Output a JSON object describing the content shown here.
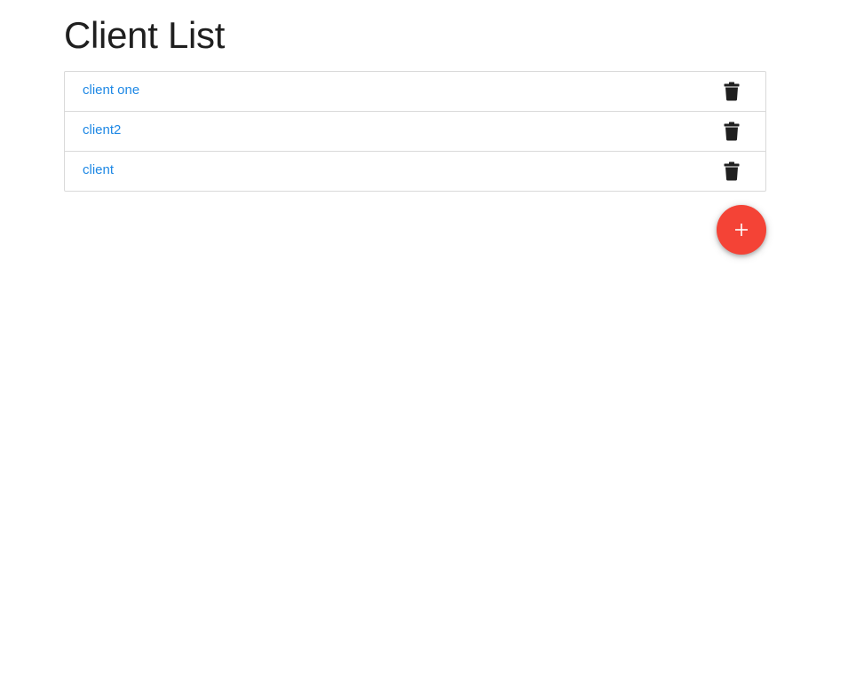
{
  "page": {
    "title": "Client List"
  },
  "clients": [
    {
      "name": "client one",
      "delete_icon": "trash-icon"
    },
    {
      "name": "client2",
      "delete_icon": "trash-icon"
    },
    {
      "name": "client",
      "delete_icon": "trash-icon"
    }
  ],
  "fab": {
    "icon": "plus-icon"
  },
  "colors": {
    "link": "#1e88e5",
    "fab": "#f44336",
    "icon": "#1f1f1f",
    "fab_icon": "#ffffff"
  }
}
